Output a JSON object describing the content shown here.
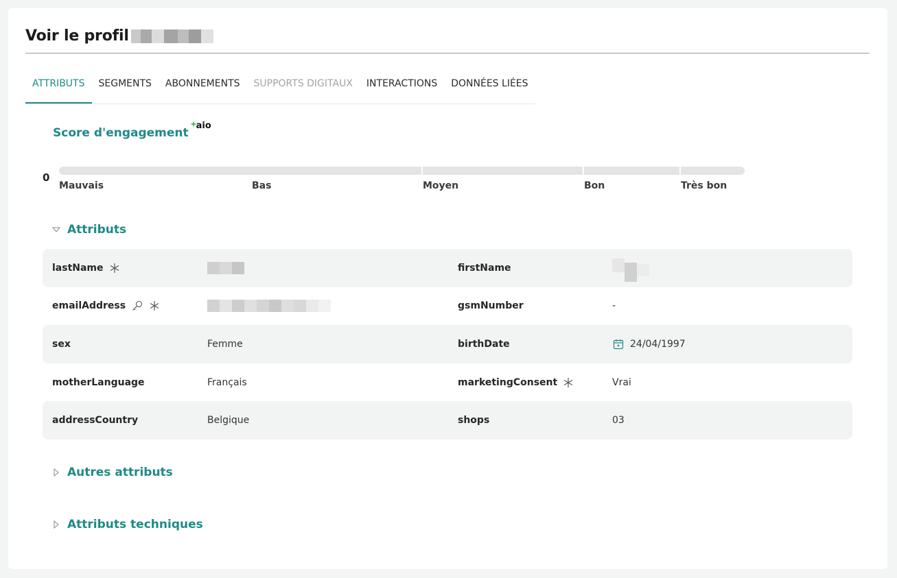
{
  "page": {
    "title": "Voir le profil"
  },
  "tabs": [
    {
      "label": "ATTRIBUTS",
      "state": "active"
    },
    {
      "label": "SEGMENTS",
      "state": "normal"
    },
    {
      "label": "ABONNEMENTS",
      "state": "normal"
    },
    {
      "label": "SUPPORTS DIGITAUX",
      "state": "disabled"
    },
    {
      "label": "INTERACTIONS",
      "state": "normal"
    },
    {
      "label": "DONNÉES LIÉES",
      "state": "normal"
    }
  ],
  "engagement": {
    "title": "Score d'engagement",
    "badge": "aio",
    "value": "0",
    "levels": [
      "Mauvais",
      "Bas",
      "Moyen",
      "Bon",
      "Très bon"
    ]
  },
  "sections": {
    "attributes": {
      "label": "Attributs",
      "expanded": true
    },
    "other": {
      "label": "Autres attributs",
      "expanded": false
    },
    "technical": {
      "label": "Attributs techniques",
      "expanded": false
    }
  },
  "attributes": {
    "lastName": {
      "key": "lastName",
      "value": ""
    },
    "firstName": {
      "key": "firstName",
      "value": ""
    },
    "emailAddress": {
      "key": "emailAddress",
      "value": ""
    },
    "gsmNumber": {
      "key": "gsmNumber",
      "value": "-"
    },
    "sex": {
      "key": "sex",
      "value": "Femme"
    },
    "birthDate": {
      "key": "birthDate",
      "value": "24/04/1997"
    },
    "motherLanguage": {
      "key": "motherLanguage",
      "value": "Français"
    },
    "marketingConsent": {
      "key": "marketingConsent",
      "value": "Vrai"
    },
    "addressCountry": {
      "key": "addressCountry",
      "value": "Belgique"
    },
    "shops": {
      "key": "shops",
      "value": "03"
    }
  },
  "colors": {
    "accent": "#1f8a87",
    "disabled_tab": "#a3a3a3",
    "row_shade": "#f2f3f3",
    "bar": "#e4e4e4"
  },
  "icons": {
    "required": "asterisk-icon",
    "identifier": "key-icon",
    "date": "calendar-icon",
    "expanded": "caret-down-icon",
    "collapsed": "caret-right-icon"
  }
}
